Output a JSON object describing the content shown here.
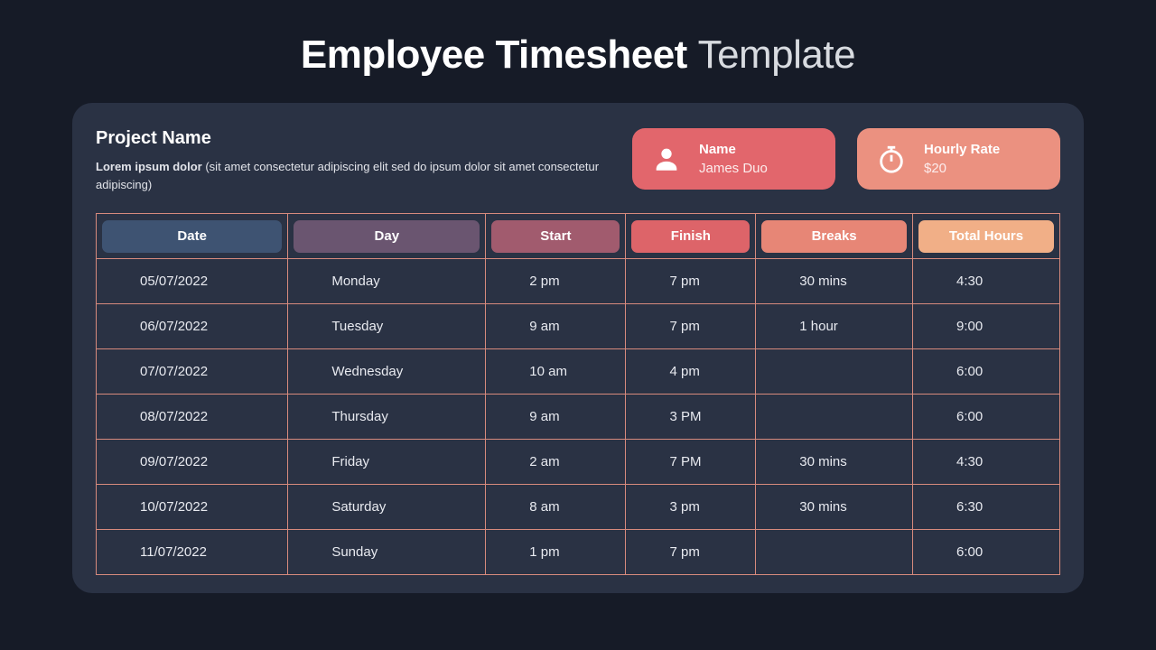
{
  "title": {
    "bold": "Employee Timesheet",
    "light": "Template"
  },
  "project": {
    "label": "Project Name",
    "desc_bold": "Lorem ipsum dolor",
    "desc_rest": "  (sit amet consectetur adipiscing elit sed do ipsum dolor sit amet consectetur adipiscing)"
  },
  "name_card": {
    "label": "Name",
    "value": "James Duo"
  },
  "rate_card": {
    "label": "Hourly Rate",
    "value": "$20"
  },
  "columns": {
    "date": "Date",
    "day": "Day",
    "start": "Start",
    "finish": "Finish",
    "breaks": "Breaks",
    "total": "Total Hours"
  },
  "rows": [
    {
      "date": "05/07/2022",
      "day": "Monday",
      "start": "2 pm",
      "finish": "7 pm",
      "breaks": "30 mins",
      "total": "4:30"
    },
    {
      "date": "06/07/2022",
      "day": "Tuesday",
      "start": "9 am",
      "finish": "7 pm",
      "breaks": "1 hour",
      "total": "9:00"
    },
    {
      "date": "07/07/2022",
      "day": "Wednesday",
      "start": "10 am",
      "finish": "4 pm",
      "breaks": "",
      "total": "6:00"
    },
    {
      "date": "08/07/2022",
      "day": "Thursday",
      "start": "9 am",
      "finish": "3 PM",
      "breaks": "",
      "total": "6:00"
    },
    {
      "date": "09/07/2022",
      "day": "Friday",
      "start": "2 am",
      "finish": "7 PM",
      "breaks": "30 mins",
      "total": "4:30"
    },
    {
      "date": "10/07/2022",
      "day": "Saturday",
      "start": "8 am",
      "finish": "3 pm",
      "breaks": "30 mins",
      "total": "6:30"
    },
    {
      "date": "11/07/2022",
      "day": "Sunday",
      "start": "1 pm",
      "finish": "7 pm",
      "breaks": "",
      "total": "6:00"
    }
  ]
}
